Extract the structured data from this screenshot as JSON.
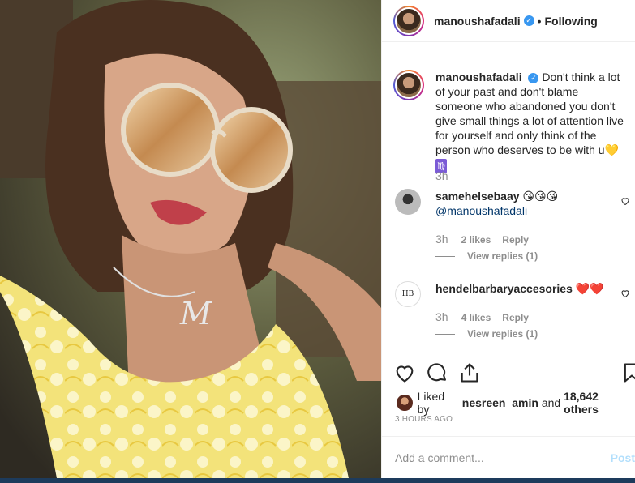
{
  "post": {
    "username": "manoushafadali",
    "follow_status": "Following",
    "dot": "•",
    "verified_glyph": "✓"
  },
  "caption": {
    "username": "manoushafadali",
    "text": "Don't think a lot of your past and don't blame someone who abandoned you don't give small things a lot of attention live for yourself and only think of the person who deserves to be with u",
    "emoji_heart": "💛",
    "emoji_virgo": "♍",
    "time": "3h"
  },
  "comments": [
    {
      "username": "samehelsebaay",
      "emojis": "😘😘😘",
      "mention": "@manoushafadali",
      "time": "3h",
      "likes": "2 likes",
      "reply": "Reply",
      "view_replies": "View replies (1)"
    },
    {
      "username": "hendelbarbaryaccesories",
      "emojis": "❤️❤️",
      "avatar_text": "HB",
      "time": "3h",
      "likes": "4 likes",
      "reply": "Reply",
      "view_replies": "View replies (1)"
    }
  ],
  "likes": {
    "prefix": "Liked by",
    "user": "nesreen_amin",
    "and": "and",
    "count": "18,642 others"
  },
  "posted_ago": "3 HOURS AGO",
  "comment_box": {
    "placeholder": "Add a comment...",
    "post_label": "Post"
  },
  "colors": {
    "verified": "#3897f0",
    "secondary_text": "#8e8e8e",
    "post_button_disabled": "#b2dffc",
    "like_heart": "#ed4956"
  },
  "icons": [
    "heart-icon",
    "comment-icon",
    "share-icon",
    "bookmark-icon",
    "verified-icon"
  ]
}
